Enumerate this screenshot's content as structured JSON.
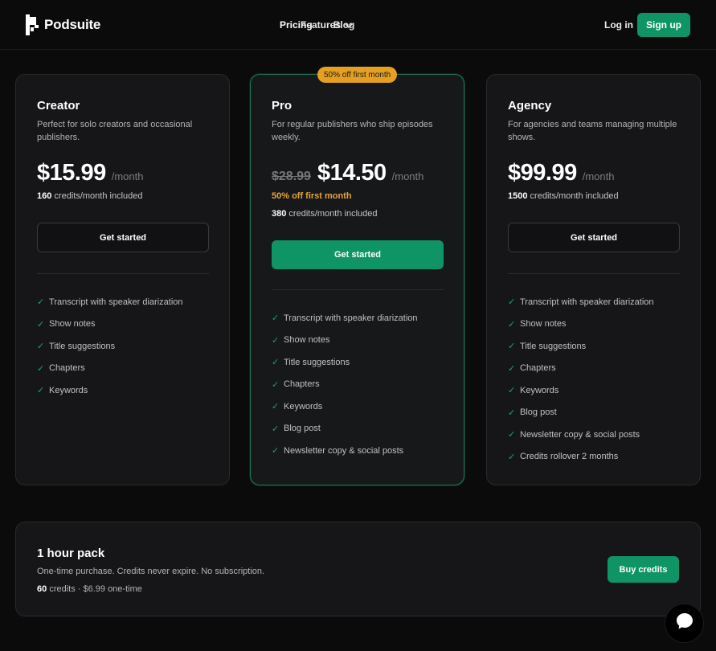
{
  "brand": {
    "name": "Podsuite"
  },
  "nav": {
    "features": "Features",
    "pricing": "Pricing",
    "blog": "Blog"
  },
  "auth": {
    "login": "Log in",
    "signup": "Sign up"
  },
  "plans": {
    "creator": {
      "name": "Creator",
      "description": "Perfect for solo creators and occasional publishers.",
      "price": "$15.99",
      "period": "/month",
      "credits_count": "160",
      "credits_text": "credits/month included",
      "cta": "Get started",
      "features": [
        "Transcript with speaker diarization",
        "Show notes",
        "Title suggestions",
        "Chapters",
        "Keywords"
      ]
    },
    "pro": {
      "badge": "50% off first month",
      "name": "Pro",
      "description": "For regular publishers who ship episodes weekly.",
      "old_price": "$28.99",
      "price": "$14.50",
      "period": "/month",
      "discount": "50% off first month",
      "credits_count": "380",
      "credits_text": "credits/month included",
      "cta": "Get started",
      "features": [
        "Transcript with speaker diarization",
        "Show notes",
        "Title suggestions",
        "Chapters",
        "Keywords",
        "Blog post",
        "Newsletter copy & social posts"
      ]
    },
    "agency": {
      "name": "Agency",
      "description": "For agencies and teams managing multiple shows.",
      "price": "$99.99",
      "period": "/month",
      "credits_count": "1500",
      "credits_text": "credits/month included",
      "cta": "Get started",
      "features": [
        "Transcript with speaker diarization",
        "Show notes",
        "Title suggestions",
        "Chapters",
        "Keywords",
        "Blog post",
        "Newsletter copy & social posts",
        "Credits rollover 2 months"
      ]
    }
  },
  "pack": {
    "title": "1 hour pack",
    "description": "One-time purchase. Credits never expire. No subscription.",
    "credits_count": "60",
    "credits_text": "credits · $6.99 one-time",
    "cta": "Buy credits"
  },
  "icons": {
    "logo": "podsuite-logo-icon",
    "chevron": "chevron-down-icon",
    "check": "check-icon",
    "chat": "chat-bubble-icon"
  },
  "colors": {
    "accent": "#0f9465",
    "promo": "#e6a021",
    "check": "#17a673",
    "background": "#0b0b0c"
  }
}
